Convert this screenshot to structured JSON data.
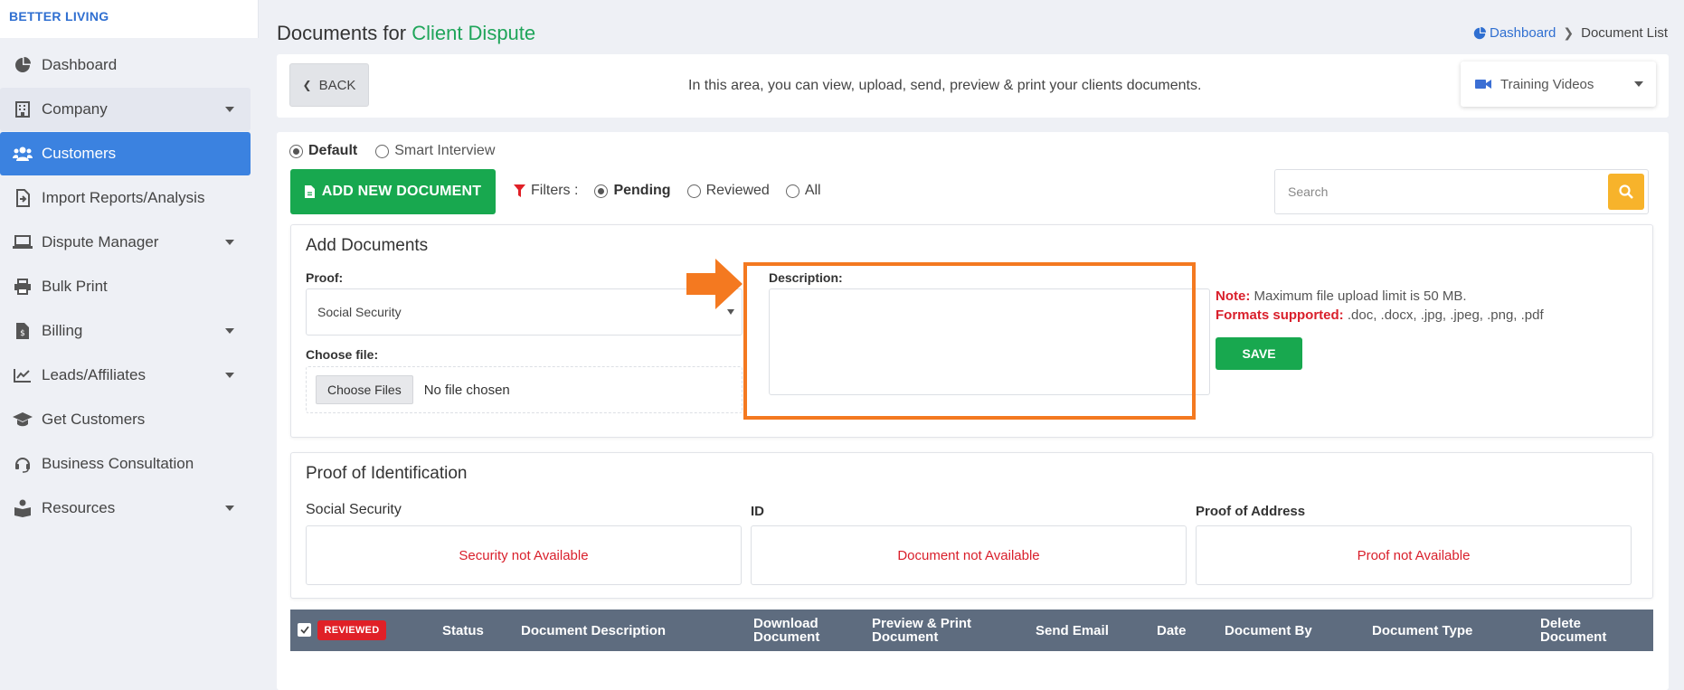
{
  "brand": "BETTER LIVING",
  "sidebar": {
    "items": [
      {
        "label": "Dashboard",
        "icon": "pie-chart-icon"
      },
      {
        "label": "Company",
        "icon": "building-icon",
        "caret": true
      },
      {
        "label": "Customers",
        "icon": "users-icon",
        "active": true
      },
      {
        "label": "Import Reports/Analysis",
        "icon": "file-import-icon"
      },
      {
        "label": "Dispute Manager",
        "icon": "laptop-icon",
        "caret": true
      },
      {
        "label": "Bulk Print",
        "icon": "printer-icon"
      },
      {
        "label": "Billing",
        "icon": "invoice-icon",
        "caret": true
      },
      {
        "label": "Leads/Affiliates",
        "icon": "line-chart-icon",
        "caret": true
      },
      {
        "label": "Get Customers",
        "icon": "graduation-cap-icon"
      },
      {
        "label": "Business Consultation",
        "icon": "headset-icon"
      },
      {
        "label": "Resources",
        "icon": "book-reader-icon",
        "caret": true
      }
    ]
  },
  "header": {
    "title_prefix": "Documents for",
    "title_highlight": "Client Dispute",
    "breadcrumb": {
      "link": "Dashboard",
      "current": "Document List"
    }
  },
  "topbar": {
    "back_label": "BACK",
    "info": "In this area, you can view, upload, send, preview & print your clients documents.",
    "training_label": "Training Videos"
  },
  "mode": {
    "default_label": "Default",
    "smart_label": "Smart Interview",
    "selected": "Default"
  },
  "toolbar": {
    "add_label": "ADD NEW DOCUMENT",
    "filters_label": "Filters :",
    "filter_options": [
      "Pending",
      "Reviewed",
      "All"
    ],
    "filter_selected": "Pending",
    "search_placeholder": "Search"
  },
  "add_documents": {
    "title": "Add Documents",
    "proof_label": "Proof:",
    "proof_value": "Social Security",
    "file_label": "Choose file:",
    "choose_btn": "Choose Files",
    "no_file": "No file chosen",
    "description_label": "Description:",
    "note_label": "Note:",
    "note_text": "Maximum file upload limit is 50 MB.",
    "formats_label": "Formats supported:",
    "formats_text": ".doc, .docx, .jpg, .jpeg, .png, .pdf",
    "save_label": "SAVE"
  },
  "proof_of_id": {
    "title": "Proof of Identification",
    "columns": [
      {
        "label": "Social Security",
        "status": "Security not Available"
      },
      {
        "label": "ID",
        "status": "Document not Available"
      },
      {
        "label": "Proof of Address",
        "status": "Proof not Available"
      }
    ]
  },
  "table": {
    "badge": "REVIEWED",
    "headers": [
      "Status",
      "Document Description",
      "Download Document",
      "Preview & Print Document",
      "Send Email",
      "Date",
      "Document By",
      "Document Type",
      "Delete Document"
    ]
  },
  "colors": {
    "accent_green": "#18a84f",
    "primary_blue": "#3b82e0",
    "highlight_orange": "#f47920",
    "error_red": "#d91f2b",
    "search_yellow": "#f7b32b"
  }
}
